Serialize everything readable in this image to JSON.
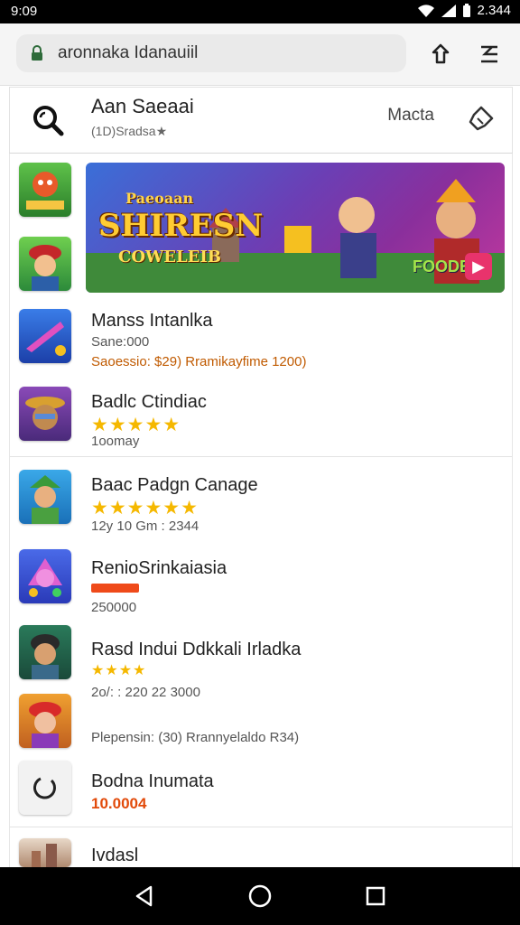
{
  "status_bar": {
    "time": "9:09",
    "right_time": "2.344"
  },
  "browser": {
    "url": "aronnaka Idanauiil"
  },
  "header": {
    "title": "Aan Saeaai",
    "subtitle": "(1D)Sradsa★",
    "match_label": "Macta"
  },
  "banner": {
    "top_text": "Paeoaan",
    "title": "SHIRESN",
    "sub": "COWELEIB",
    "logo": "FOODE"
  },
  "items": [
    {
      "title": "Manss Intanlka",
      "sub": "Sane:000",
      "meta": "Saoessio: $29) Rramikayfime 1200)"
    },
    {
      "title": "Badlc Ctindiac",
      "stars": "★★★★★",
      "sub": "1oomay"
    },
    {
      "title": "Baac Padgn Canage",
      "stars": "★★★★★★",
      "sub": "12y 10 Gm : 2344"
    },
    {
      "title": "RenioSrinkaiasia",
      "progress": 0.8,
      "sub": "250000"
    },
    {
      "title": "Rasd Indui Ddkkali Irladka",
      "stars": "★★★★",
      "sub": "2o/: : 220 22 3000"
    },
    {
      "title": "",
      "sub": "Plepensin: (30) Rrannyelaldo R34)"
    },
    {
      "title": "Bodna Inumata",
      "price": "10.0004"
    },
    {
      "title": "Ivdasl"
    }
  ],
  "colors": {
    "accent": "#e24a0a",
    "star": "#f5b800",
    "banner_start": "#3a6fd8",
    "banner_end": "#c0389e"
  },
  "icons": {
    "lock": "lock-icon",
    "share": "share-icon",
    "tabs": "tabs-icon",
    "search": "search-icon",
    "diamond": "tag-icon",
    "back": "back-icon",
    "home": "home-icon",
    "recents": "recents-icon",
    "loading": "refresh-icon"
  }
}
